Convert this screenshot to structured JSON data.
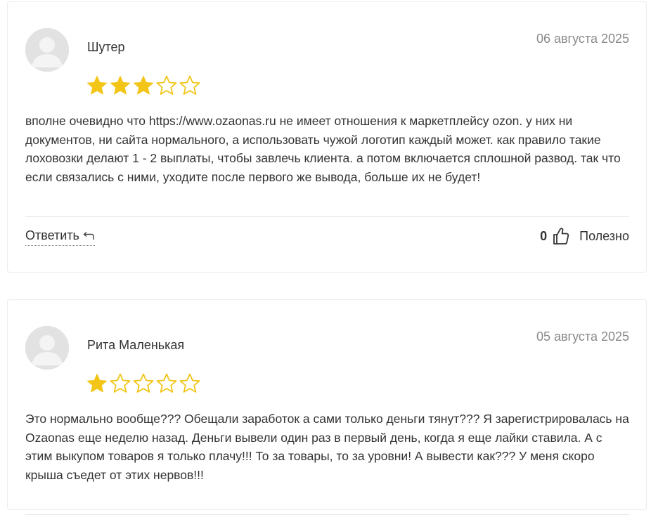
{
  "colors": {
    "star_filled": "#f2c517",
    "star_empty_outline": "#f2c517",
    "date_text": "#8a8a8a",
    "body_text": "#333333"
  },
  "reviews": [
    {
      "author": "Шутер",
      "date": "06 августа 2025",
      "rating": 3,
      "rating_max": 5,
      "text": "вполне очевидно что https://www.ozaonas.ru не имеет отношения к маркетплейсу ozon. у них ни документов, ни сайта нормального, а использовать чужой логотип каждый может. как правило такие лоховозки делают 1 - 2 выплаты, чтобы завлечь клиента. а потом включается сплошной развод. так что если связались с ними, уходите после первого же вывода, больше их не будет!",
      "reply_label": "Ответить",
      "helpful_count": "0",
      "helpful_label": "Полезно"
    },
    {
      "author": "Рита Маленькая",
      "date": "05 августа 2025",
      "rating": 1,
      "rating_max": 5,
      "text": "Это нормально вообще??? Обещали заработок а сами только деньги тянут??? Я зарегистрировалась на Ozaonas еще неделю назад. Деньги вывели один раз в первый день, когда я еще лайки ставила. А с этим выкупом товаров я только плачу!!! То за товары, то за уровни! А вывести как??? У меня скоро крыша съедет от этих нервов!!!"
    }
  ],
  "icons": {
    "avatar": "user-avatar-icon",
    "star": "star-icon",
    "reply": "reply-arrow-icon",
    "helpful": "thumbs-up-icon"
  }
}
